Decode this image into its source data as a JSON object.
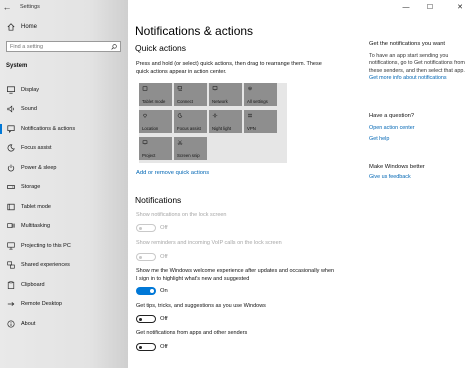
{
  "window": {
    "title": "Settings",
    "back_glyph": "←",
    "controls": {
      "minimize": "—",
      "maximize": "☐",
      "close": "✕"
    }
  },
  "sidebar": {
    "home_label": "Home",
    "search_placeholder": "Find a setting",
    "section_label": "System",
    "items": [
      {
        "label": "Display",
        "icon": "display-icon"
      },
      {
        "label": "Sound",
        "icon": "sound-icon"
      },
      {
        "label": "Notifications & actions",
        "icon": "notifications-icon",
        "active": true
      },
      {
        "label": "Focus assist",
        "icon": "moon-icon"
      },
      {
        "label": "Power & sleep",
        "icon": "power-icon"
      },
      {
        "label": "Storage",
        "icon": "storage-icon"
      },
      {
        "label": "Tablet mode",
        "icon": "tablet-icon"
      },
      {
        "label": "Multitasking",
        "icon": "multitasking-icon"
      },
      {
        "label": "Projecting to this PC",
        "icon": "projecting-icon"
      },
      {
        "label": "Shared experiences",
        "icon": "shared-experiences-icon"
      },
      {
        "label": "Clipboard",
        "icon": "clipboard-icon"
      },
      {
        "label": "Remote Desktop",
        "icon": "remote-desktop-icon"
      },
      {
        "label": "About",
        "icon": "info-icon"
      }
    ]
  },
  "main": {
    "page_title": "Notifications & actions",
    "quick_actions": {
      "heading": "Quick actions",
      "description": "Press and hold (or select) quick actions, then drag to rearrange them. These quick actions appear in action center.",
      "tiles": [
        {
          "label": "Tablet mode",
          "icon": "tablet-icon"
        },
        {
          "label": "Connect",
          "icon": "connect-icon"
        },
        {
          "label": "Network",
          "icon": "network-icon"
        },
        {
          "label": "All settings",
          "icon": "gear-icon"
        },
        {
          "label": "Location",
          "icon": "location-icon"
        },
        {
          "label": "Focus assist",
          "icon": "moon-icon"
        },
        {
          "label": "Night light",
          "icon": "sun-icon"
        },
        {
          "label": "VPN",
          "icon": "vpn-icon"
        },
        {
          "label": "Project",
          "icon": "project-icon"
        },
        {
          "label": "Screen snip",
          "icon": "scissors-icon"
        }
      ],
      "link": "Add or remove quick actions"
    },
    "notifications": {
      "heading": "Notifications",
      "settings": [
        {
          "label": "Show notifications on the lock screen",
          "state": "Off",
          "on": false,
          "disabled": true
        },
        {
          "label": "Show reminders and incoming VoIP calls on the lock screen",
          "state": "Off",
          "on": false,
          "disabled": true
        },
        {
          "label": "Show me the Windows welcome experience after updates and occasionally when I sign in to highlight what's new and suggested",
          "state": "On",
          "on": true,
          "disabled": false
        },
        {
          "label": "Get tips, tricks, and suggestions as you use Windows",
          "state": "Off",
          "on": false,
          "disabled": false
        },
        {
          "label": "Get notifications from apps and other senders",
          "state": "Off",
          "on": false,
          "disabled": false
        }
      ]
    }
  },
  "right_panel": {
    "get_notifications": {
      "heading": "Get the notifications you want",
      "text": "To have an app start sending you notifications, go to Get notifications from these senders, and then select that app.",
      "link": "Get more info about notifications"
    },
    "question": {
      "heading": "Have a question?",
      "links": [
        "Open action center",
        "Get help"
      ]
    },
    "feedback": {
      "heading": "Make Windows better",
      "link": "Give us feedback"
    }
  },
  "colors": {
    "accent": "#0078d7",
    "link": "#0066b4",
    "tile": "#959595",
    "sidebar_bg": "#e6e6e6"
  }
}
